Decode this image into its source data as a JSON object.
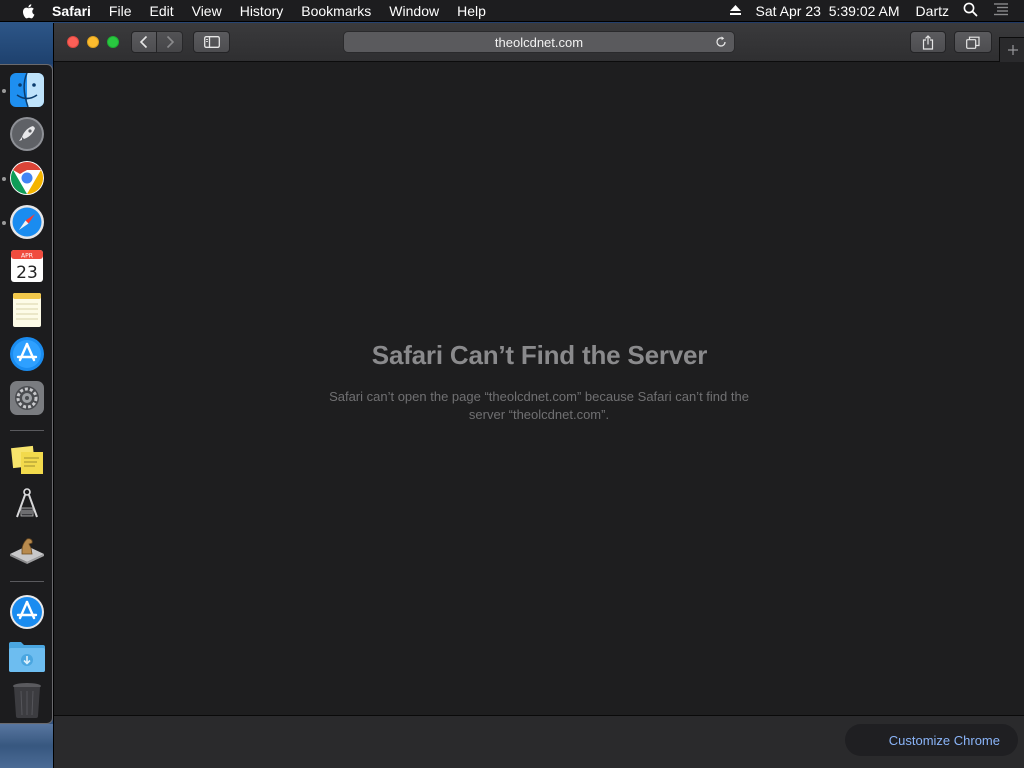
{
  "menubar": {
    "apple_icon": "apple-logo",
    "app_name": "Safari",
    "items": [
      "File",
      "Edit",
      "View",
      "History",
      "Bookmarks",
      "Window",
      "Help"
    ],
    "clock": "Sat Apr 23  5:39:02 AM",
    "user": "Dartz",
    "status_icons": [
      "eject-icon",
      "search-icon",
      "list-icon"
    ]
  },
  "dock": {
    "apps": [
      {
        "name": "Finder",
        "icon": "finder-icon",
        "running": true
      },
      {
        "name": "Launchpad",
        "icon": "rocket-icon",
        "running": false
      },
      {
        "name": "Google Chrome",
        "icon": "chrome-icon",
        "running": true
      },
      {
        "name": "Safari",
        "icon": "safari-compass-icon",
        "running": true
      },
      {
        "name": "Calendar",
        "icon": "calendar-icon",
        "running": false,
        "month": "APR",
        "day": "23"
      },
      {
        "name": "Notes",
        "icon": "notes-icon",
        "running": false
      },
      {
        "name": "App Store",
        "icon": "app-store-icon",
        "running": false
      },
      {
        "name": "System Preferences",
        "icon": "gear-icon",
        "running": false
      },
      {
        "name": "Stickies",
        "icon": "stickies-icon",
        "running": false
      },
      {
        "name": "Instruments",
        "icon": "compass-tool-icon",
        "running": false
      },
      {
        "name": "Chess",
        "icon": "chess-knight-icon",
        "running": false
      },
      {
        "name": "App Store Download",
        "icon": "app-store-icon",
        "running": false
      },
      {
        "name": "Downloads",
        "icon": "folder-icon",
        "running": false
      },
      {
        "name": "Trash",
        "icon": "trash-icon",
        "running": false
      }
    ]
  },
  "browser": {
    "address": "theolcdnet.com",
    "error_title": "Safari Can’t Find the Server",
    "error_message": "Safari can’t open the page “theolcdnet.com” because Safari can’t find the server “theolcdnet.com”.",
    "customize_label": "Customize Chrome"
  },
  "colors": {
    "close": "#fc5f57",
    "minimize": "#fdbc2e",
    "maximize": "#29c840",
    "link_accent": "#8ab4f8"
  }
}
